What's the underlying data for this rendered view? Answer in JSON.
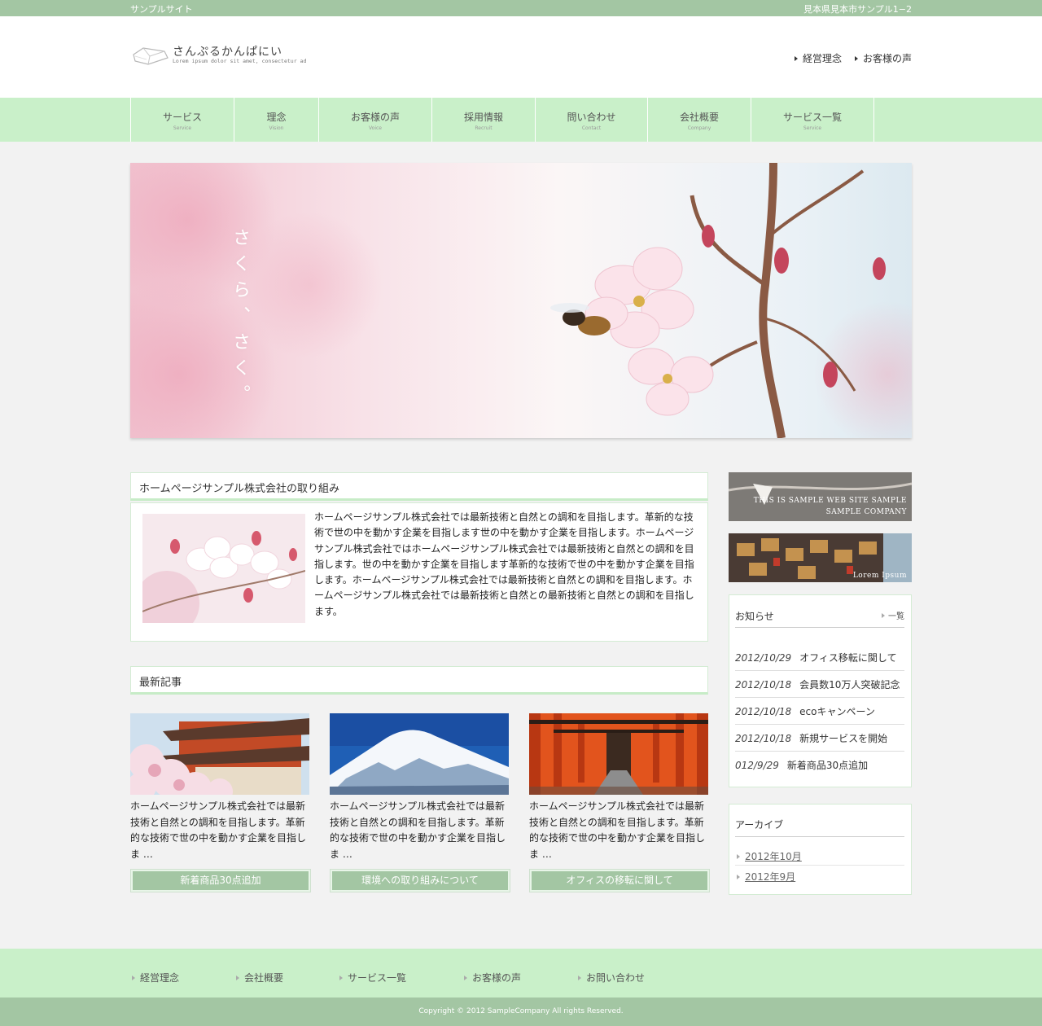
{
  "topbar": {
    "site": "サンプルサイト",
    "address": "見本県見本市サンプル1−2"
  },
  "logo": {
    "name": "さんぷるかんぱにい",
    "tagline": "Lorem ipsum dolor sit amet, consectetur ad"
  },
  "header_links": [
    {
      "label": "経営理念"
    },
    {
      "label": "お客様の声"
    }
  ],
  "nav": [
    {
      "jp": "サービス",
      "en": "Service"
    },
    {
      "jp": "理念",
      "en": "Vision"
    },
    {
      "jp": "お客様の声",
      "en": "Voice"
    },
    {
      "jp": "採用情報",
      "en": "Recruit"
    },
    {
      "jp": "問い合わせ",
      "en": "Contact"
    },
    {
      "jp": "会社概要",
      "en": "Company"
    },
    {
      "jp": "サービス一覧",
      "en": "Service"
    }
  ],
  "hero": {
    "caption": "さくら、さく。"
  },
  "intro": {
    "title": "ホームページサンプル株式会社の取り組み",
    "body": "ホームページサンプル株式会社では最新技術と自然との調和を目指します。革新的な技術で世の中を動かす企業を目指します世の中を動かす企業を目指します。ホームページサンプル株式会社ではホームページサンプル株式会社では最新技術と自然との調和を目指します。世の中を動かす企業を目指します革新的な技術で世の中を動かす企業を目指します。ホームページサンプル株式会社では最新技術と自然との調和を目指します。ホームページサンプル株式会社では最新技術と自然との最新技術と自然との調和を目指します。"
  },
  "latest": {
    "title": "最新記事",
    "cards": [
      {
        "text": "ホームページサンプル株式会社では最新技術と自然との調和を目指します。革新的な技術で世の中を動かす企業を目指しま …",
        "button": "新着商品30点追加"
      },
      {
        "text": "ホームページサンプル株式会社では最新技術と自然との調和を目指します。革新的な技術で世の中を動かす企業を目指しま …",
        "button": "環境への取り組みについて"
      },
      {
        "text": "ホームページサンプル株式会社では最新技術と自然との調和を目指します。革新的な技術で世の中を動かす企業を目指しま …",
        "button": "オフィスの移転に関して"
      }
    ]
  },
  "side_banners": [
    {
      "line1": "THIS IS SAMPLE WEB SITE SAMPLE",
      "line2": "SAMPLE COMPANY"
    },
    {
      "line1": "Lorem Ipsum"
    }
  ],
  "news": {
    "title": "お知らせ",
    "more": "一覧",
    "items": [
      {
        "date": "2012/10/29",
        "text": "オフィス移転に関して"
      },
      {
        "date": "2012/10/18",
        "text": "会員数10万人突破記念"
      },
      {
        "date": "2012/10/18",
        "text": "ecoキャンペーン"
      },
      {
        "date": "2012/10/18",
        "text": "新規サービスを開始"
      },
      {
        "date": "012/9/29",
        "text": "新着商品30点追加"
      }
    ]
  },
  "archive": {
    "title": "アーカイブ",
    "items": [
      "2012年10月",
      "2012年9月"
    ]
  },
  "footer": {
    "links": [
      "経営理念",
      "会社概要",
      "サービス一覧",
      "お客様の声",
      "お問い合わせ"
    ],
    "copyright": "Copyright © 2012 SampleCompany All rights Reserved."
  },
  "colors": {
    "accent": "#a3c6a3",
    "nav_bg": "#c9f0c9",
    "page_bg": "#f2f2f2"
  },
  "icons": {
    "link_marker": "triangle-right-icon",
    "logo": "open-book-logo"
  }
}
